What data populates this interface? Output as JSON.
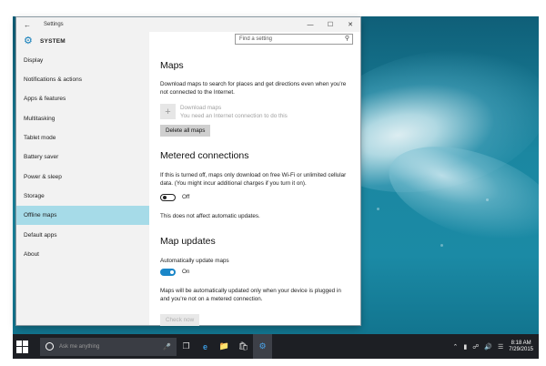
{
  "window": {
    "title": "Settings",
    "back_icon": "back-arrow-icon",
    "minimize": "—",
    "maximize": "☐",
    "close": "✕"
  },
  "sidebar": {
    "header_title": "SYSTEM",
    "items": [
      {
        "label": "Display"
      },
      {
        "label": "Notifications & actions"
      },
      {
        "label": "Apps & features"
      },
      {
        "label": "Multitasking"
      },
      {
        "label": "Tablet mode"
      },
      {
        "label": "Battery saver"
      },
      {
        "label": "Power & sleep"
      },
      {
        "label": "Storage"
      },
      {
        "label": "Offline maps",
        "active": true
      },
      {
        "label": "Default apps"
      },
      {
        "label": "About"
      }
    ]
  },
  "search": {
    "placeholder": "Find a setting"
  },
  "maps": {
    "title": "Maps",
    "description": "Download maps to search for places and get directions even when you're not connected to the Internet.",
    "download_title": "Download maps",
    "download_sub": "You need an Internet connection to do this",
    "delete_button": "Delete all maps"
  },
  "metered": {
    "title": "Metered connections",
    "description": "If this is turned off, maps only download on free Wi-Fi or unlimited cellular data. (You might incur additional charges if you turn it on).",
    "toggle_label": "Off",
    "note": "This does not affect automatic updates."
  },
  "updates": {
    "title": "Map updates",
    "auto_label": "Automatically update maps",
    "toggle_label": "On",
    "note": "Maps will be automatically updated only when your device is plugged in and you're not on a metered connection.",
    "check_button": "Check now"
  },
  "taskbar": {
    "search_placeholder": "Ask me anything",
    "time": "8:18 AM",
    "date": "7/29/2015"
  },
  "colors": {
    "accent": "#1a86c8",
    "selection": "#a6dbe8",
    "taskbar": "#1d1f24"
  }
}
